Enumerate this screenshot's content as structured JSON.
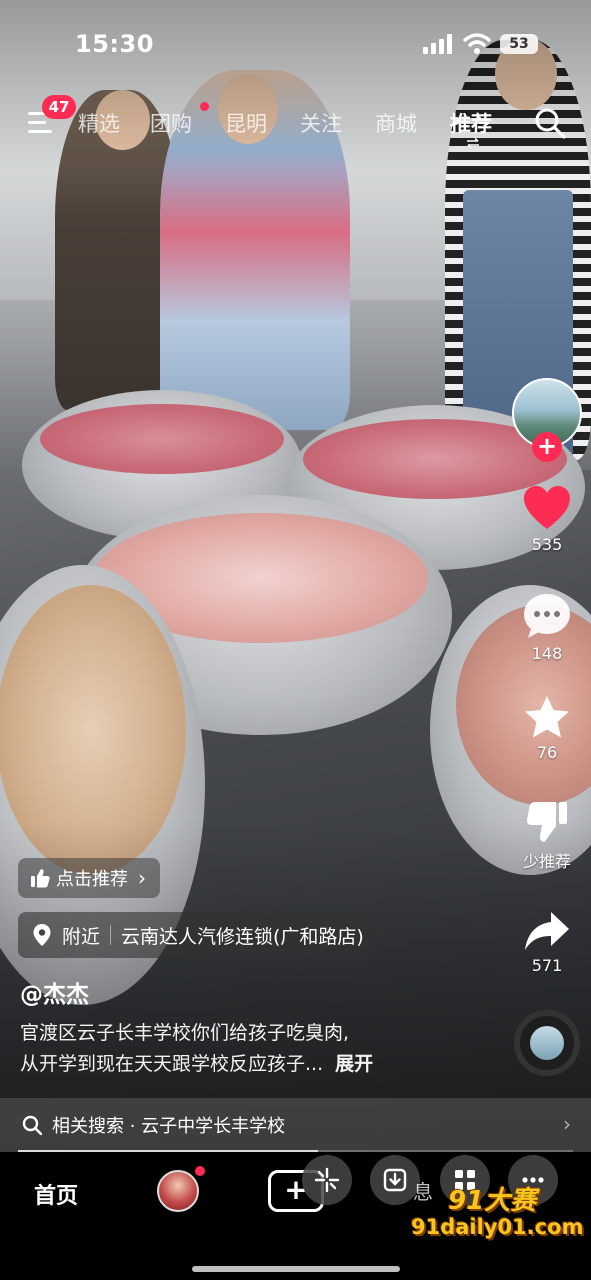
{
  "status_bar": {
    "time": "15:30",
    "battery": "53"
  },
  "top_nav": {
    "notification_count": "47",
    "tabs": [
      {
        "label": "精选",
        "active": false
      },
      {
        "label": "团购",
        "active": false
      },
      {
        "label": "昆明",
        "active": false
      },
      {
        "label": "关注",
        "active": false
      },
      {
        "label": "商城",
        "active": false
      },
      {
        "label": "推荐",
        "active": true
      }
    ]
  },
  "right_rail": {
    "likes": "535",
    "comments": "148",
    "favorites": "76",
    "dislike_label": "少推荐",
    "shares": "571"
  },
  "overlay": {
    "recommend_label": "点击推荐",
    "location_prefix": "附近",
    "location_name": "云南达人汽修连锁(广和路店)",
    "author": "@杰杰",
    "description_line1": "官渡区云子长丰学校你们给孩子吃臭肉,",
    "description_line2": "从开学到现在天天跟学校反应孩子...",
    "expand_label": "展开",
    "related_search": "相关搜索 · 云子中学长丰学校",
    "progress": 0.54
  },
  "bottom_nav": {
    "home_label": "首页",
    "messages_label": "息"
  },
  "watermark": {
    "line1": "91大赛",
    "line2": "91daily01.com"
  },
  "colors": {
    "accent": "#fe2c55",
    "watermark": "#f7c51e"
  }
}
